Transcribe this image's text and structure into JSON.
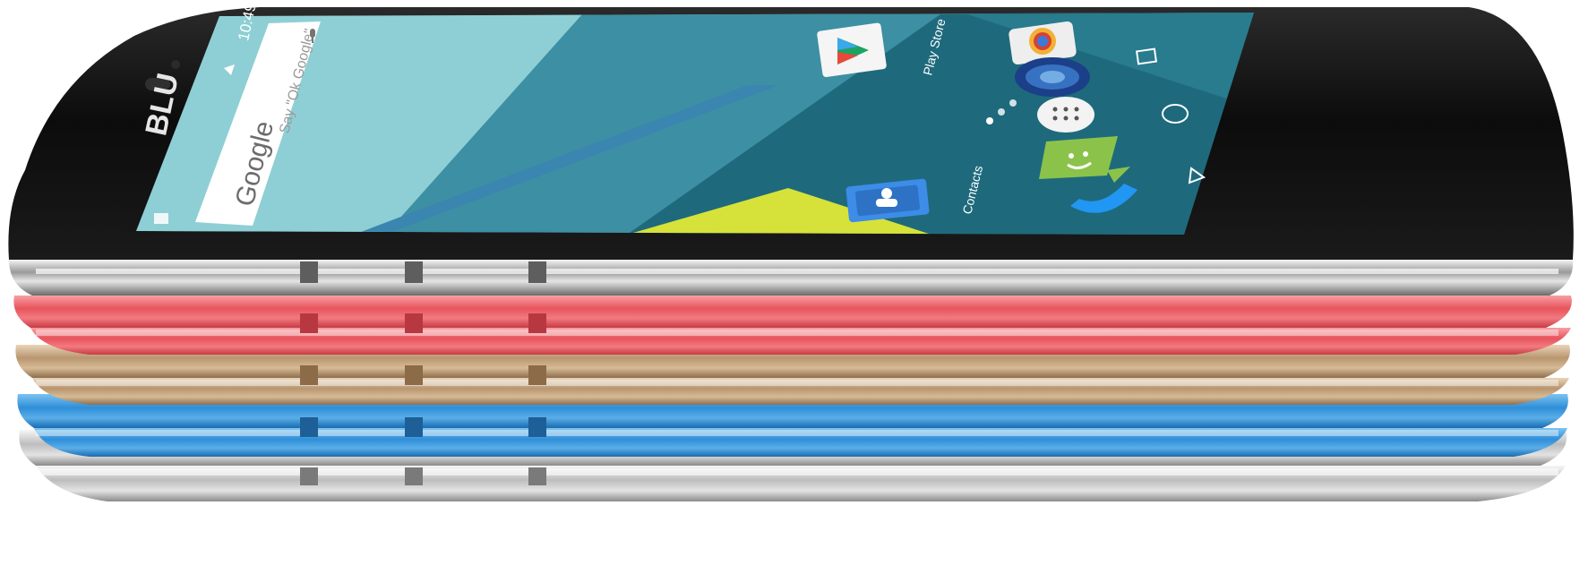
{
  "brand": {
    "logo_text": "BLU"
  },
  "status_bar": {
    "time": "10:49"
  },
  "search_bar": {
    "google_text": "Google",
    "placeholder": "Say \"Ok Google\""
  },
  "apps": [
    {
      "label": "Play Store",
      "icon": "play-store-icon"
    },
    {
      "label": "",
      "icon": "camera-icon"
    },
    {
      "label": "",
      "icon": "browser-globe-icon"
    },
    {
      "label": "",
      "icon": "app-drawer-icon"
    },
    {
      "label": "",
      "icon": "messaging-icon"
    },
    {
      "label": "",
      "icon": "phone-icon"
    },
    {
      "label": "Contacts",
      "icon": "contacts-icon"
    }
  ],
  "nav_buttons": [
    {
      "icon": "recents-square-icon"
    },
    {
      "icon": "home-circle-icon"
    },
    {
      "icon": "back-triangle-icon"
    }
  ],
  "phone_colors": [
    {
      "name": "black",
      "hex": "#1a1a1a"
    },
    {
      "name": "red",
      "hex": "#e8545c"
    },
    {
      "name": "gold",
      "hex": "#b89670"
    },
    {
      "name": "blue",
      "hex": "#2f8fd8"
    },
    {
      "name": "silver",
      "hex": "#c9c9c9"
    }
  ],
  "colors": {
    "wallpaper_dark": "#1e6a7c",
    "wallpaper_mid": "#3d8fa3",
    "wallpaper_light": "#8ecfd5",
    "wallpaper_stripe": "#3a86b0",
    "wallpaper_yellow": "#d6e23a"
  }
}
